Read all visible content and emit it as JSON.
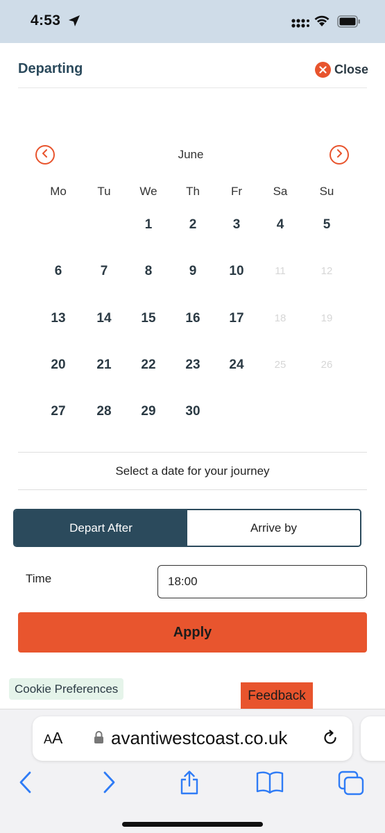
{
  "status_bar": {
    "time": "4:53",
    "icons": [
      "location-arrow-icon",
      "signal-icon",
      "wifi-icon",
      "battery-icon"
    ]
  },
  "header": {
    "title": "Departing",
    "close_label": "Close"
  },
  "calendar": {
    "month": "June",
    "weekdays": [
      "Mo",
      "Tu",
      "We",
      "Th",
      "Fr",
      "Sa",
      "Su"
    ],
    "weeks": [
      [
        {
          "day": "",
          "available": false
        },
        {
          "day": "",
          "available": false
        },
        {
          "day": "1",
          "available": true
        },
        {
          "day": "2",
          "available": true
        },
        {
          "day": "3",
          "available": true
        },
        {
          "day": "4",
          "available": true
        },
        {
          "day": "5",
          "available": true
        }
      ],
      [
        {
          "day": "6",
          "available": true
        },
        {
          "day": "7",
          "available": true
        },
        {
          "day": "8",
          "available": true
        },
        {
          "day": "9",
          "available": true
        },
        {
          "day": "10",
          "available": true
        },
        {
          "day": "11",
          "available": false
        },
        {
          "day": "12",
          "available": false
        }
      ],
      [
        {
          "day": "13",
          "available": true
        },
        {
          "day": "14",
          "available": true
        },
        {
          "day": "15",
          "available": true
        },
        {
          "day": "16",
          "available": true
        },
        {
          "day": "17",
          "available": true
        },
        {
          "day": "18",
          "available": false
        },
        {
          "day": "19",
          "available": false
        }
      ],
      [
        {
          "day": "20",
          "available": true
        },
        {
          "day": "21",
          "available": true
        },
        {
          "day": "22",
          "available": true
        },
        {
          "day": "23",
          "available": true
        },
        {
          "day": "24",
          "available": true
        },
        {
          "day": "25",
          "available": false
        },
        {
          "day": "26",
          "available": false
        }
      ],
      [
        {
          "day": "27",
          "available": true
        },
        {
          "day": "28",
          "available": true
        },
        {
          "day": "29",
          "available": true
        },
        {
          "day": "30",
          "available": true
        },
        {
          "day": "",
          "available": false
        },
        {
          "day": "",
          "available": false
        },
        {
          "day": "",
          "available": false
        }
      ]
    ]
  },
  "journey": {
    "hint": "Select a date for your journey",
    "toggle": {
      "depart_after": "Depart After",
      "arrive_by": "Arrive by",
      "selected": "depart_after"
    },
    "time_label": "Time",
    "time_value": "18:00",
    "apply_label": "Apply"
  },
  "footer": {
    "cookie_label": "Cookie Preferences",
    "feedback_label": "Feedback"
  },
  "browser": {
    "aa_small": "A",
    "aa_large": "A",
    "url": "avantiwestcoast.co.uk"
  },
  "colors": {
    "accent": "#e8542d",
    "primary_dark": "#2b4a5c",
    "disabled_day": "#d6d6d6",
    "cookie_bg": "#e5f4ea",
    "status_bar_bg": "#cfdce8"
  }
}
